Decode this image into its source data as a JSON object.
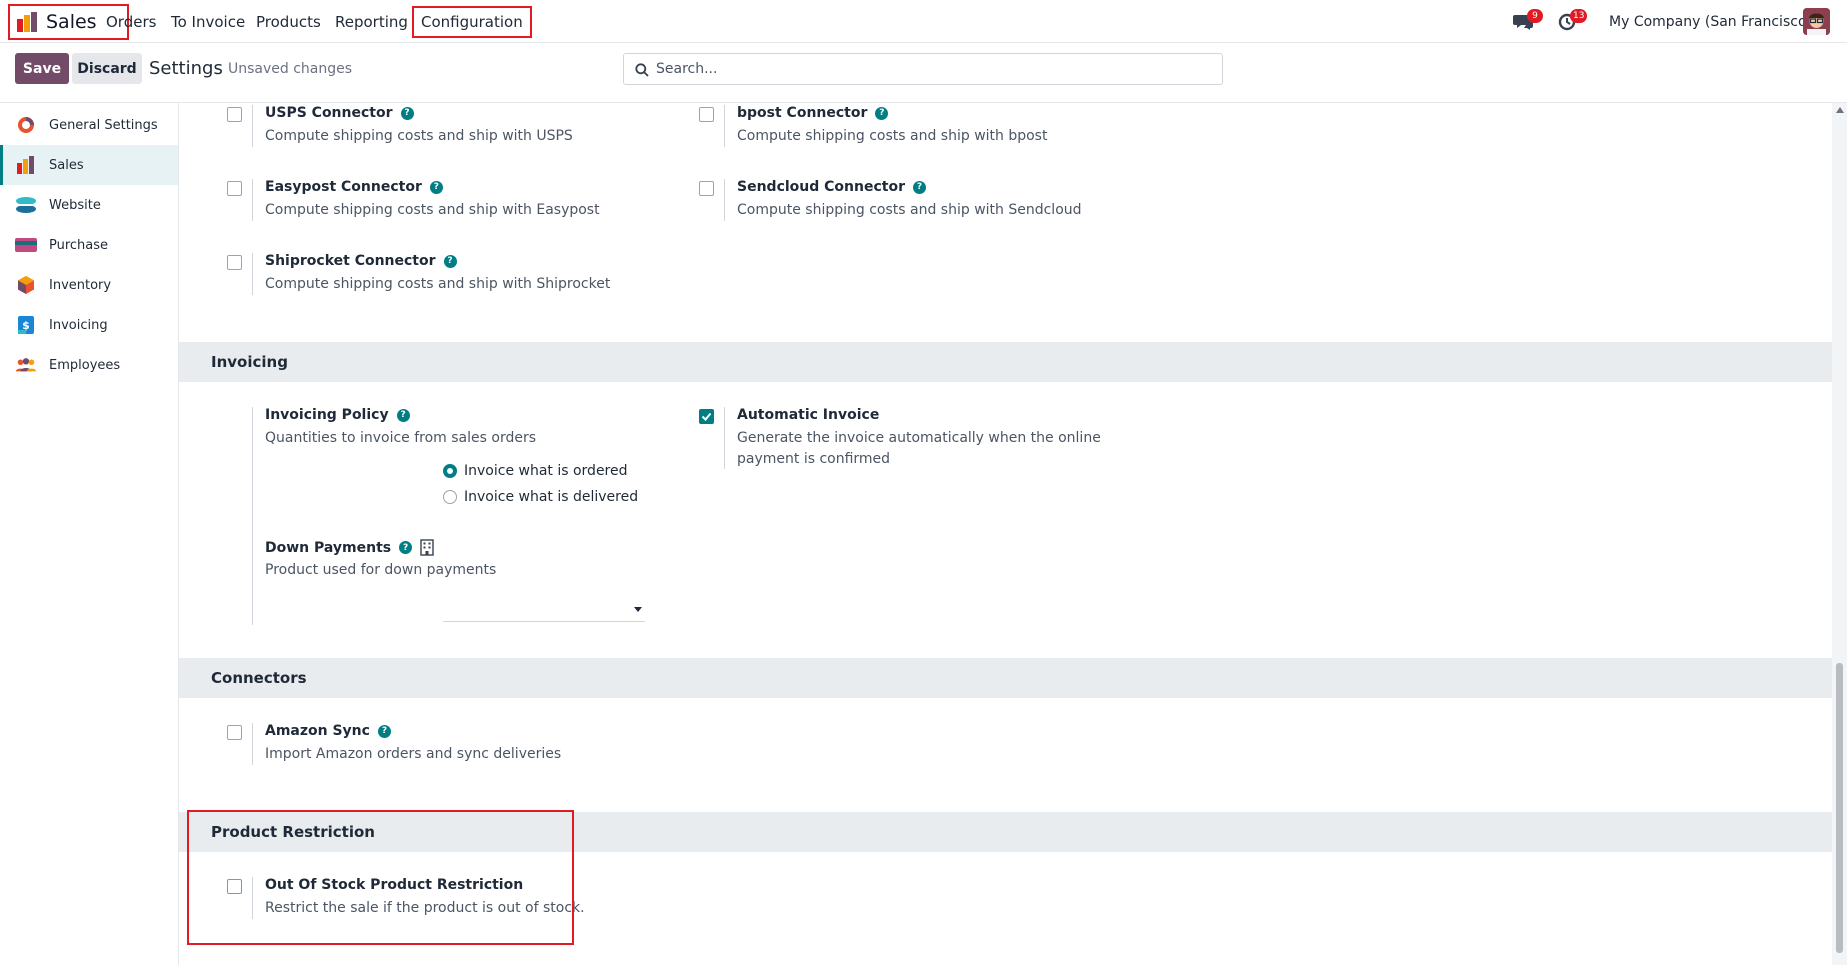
{
  "navbar": {
    "app_name": "Sales",
    "menu": [
      "Orders",
      "To Invoice",
      "Products",
      "Reporting",
      "Configuration"
    ],
    "messages_count": "9",
    "activities_count": "13",
    "company": "My Company (San Francisco)"
  },
  "control_panel": {
    "save_label": "Save",
    "discard_label": "Discard",
    "title": "Settings",
    "status": "Unsaved changes",
    "search_placeholder": "Search..."
  },
  "sidebar": {
    "items": [
      {
        "label": "General Settings",
        "icon": "general-settings-icon"
      },
      {
        "label": "Sales",
        "icon": "sales-app-icon",
        "active": true
      },
      {
        "label": "Website",
        "icon": "website-app-icon"
      },
      {
        "label": "Purchase",
        "icon": "purchase-app-icon"
      },
      {
        "label": "Inventory",
        "icon": "inventory-app-icon"
      },
      {
        "label": "Invoicing",
        "icon": "invoicing-app-icon"
      },
      {
        "label": "Employees",
        "icon": "employees-app-icon"
      }
    ]
  },
  "shipping": {
    "usps": {
      "title": "USPS Connector",
      "desc": "Compute shipping costs and ship with USPS",
      "checked": false
    },
    "bpost": {
      "title": "bpost Connector",
      "desc": "Compute shipping costs and ship with bpost",
      "checked": false
    },
    "easypost": {
      "title": "Easypost Connector",
      "desc": "Compute shipping costs and ship with Easypost",
      "checked": false
    },
    "sendcloud": {
      "title": "Sendcloud Connector",
      "desc": "Compute shipping costs and ship with Sendcloud",
      "checked": false
    },
    "shiprocket": {
      "title": "Shiprocket Connector",
      "desc": "Compute shipping costs and ship with Shiprocket",
      "checked": false
    }
  },
  "invoicing": {
    "section_title": "Invoicing",
    "policy": {
      "title": "Invoicing Policy",
      "desc": "Quantities to invoice from sales orders",
      "options": [
        "Invoice what is ordered",
        "Invoice what is delivered"
      ],
      "selected": "Invoice what is ordered"
    },
    "automatic_invoice": {
      "title": "Automatic Invoice",
      "desc": "Generate the invoice automatically when the online payment is confirmed",
      "checked": true
    },
    "down_payments": {
      "title": "Down Payments",
      "desc": "Product used for down payments",
      "value": ""
    }
  },
  "connectors": {
    "section_title": "Connectors",
    "amazon": {
      "title": "Amazon Sync",
      "desc": "Import Amazon orders and sync deliveries",
      "checked": false
    }
  },
  "product_restriction": {
    "section_title": "Product Restriction",
    "out_of_stock": {
      "title": "Out Of Stock Product Restriction",
      "desc": "Restrict the sale if the product is out of stock.",
      "checked": false
    }
  },
  "colors": {
    "brand": "#714b67",
    "accent": "#017e84",
    "highlight": "#e01b24"
  }
}
